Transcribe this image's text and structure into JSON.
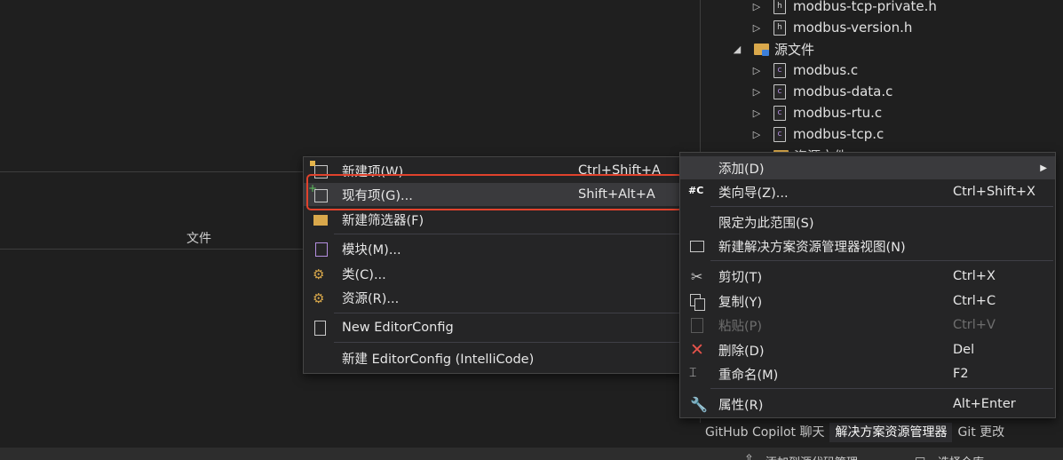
{
  "output_panel": {
    "column_file": "文件"
  },
  "solution_explorer": {
    "rows": [
      {
        "name": "modbus-tcp-private.h",
        "type": "h",
        "arrow": "▷"
      },
      {
        "name": "modbus-version.h",
        "type": "h",
        "arrow": "▷"
      },
      {
        "name": "源文件",
        "type": "folder",
        "arrow": "◢"
      },
      {
        "name": "modbus.c",
        "type": "c",
        "arrow": "▷"
      },
      {
        "name": "modbus-data.c",
        "type": "c",
        "arrow": "▷"
      },
      {
        "name": "modbus-rtu.c",
        "type": "c",
        "arrow": "▷"
      },
      {
        "name": "modbus-tcp.c",
        "type": "c",
        "arrow": "▷"
      },
      {
        "name": "资源文件",
        "type": "folder",
        "arrow": "▷"
      }
    ],
    "file_icon_h": "h",
    "file_icon_c": "c"
  },
  "tabs": [
    "GitHub Copilot 聊天",
    "解决方案资源管理器",
    "Git 更改"
  ],
  "status_bar": {
    "left": "添加到源代码管理",
    "right": "选择仓库"
  },
  "submenu": {
    "items": [
      {
        "label": "新建项(W)...",
        "shortcut": "Ctrl+Shift+A",
        "icon": "new-item-icon"
      },
      {
        "label": "现有项(G)...",
        "shortcut": "Shift+Alt+A",
        "icon": "existing-item-icon"
      },
      {
        "label": "新建筛选器(F)",
        "shortcut": "",
        "icon": "new-filter-icon"
      },
      {
        "label": "模块(M)...",
        "shortcut": "",
        "icon": "module-icon"
      },
      {
        "label": "类(C)...",
        "shortcut": "",
        "icon": "class-icon"
      },
      {
        "label": "资源(R)...",
        "shortcut": "",
        "icon": "resource-icon"
      },
      {
        "label": "New EditorConfig",
        "shortcut": "",
        "icon": "document-icon"
      },
      {
        "label": "新建 EditorConfig (IntelliCode)",
        "shortcut": "",
        "icon": ""
      }
    ]
  },
  "main_menu": {
    "items": [
      {
        "label": "添加(D)",
        "shortcut": "",
        "icon": ""
      },
      {
        "label": "类向导(Z)...",
        "shortcut": "Ctrl+Shift+X",
        "icon": "class-wizard-icon"
      },
      {
        "label": "限定为此范围(S)",
        "shortcut": "",
        "icon": ""
      },
      {
        "label": "新建解决方案资源管理器视图(N)",
        "shortcut": "",
        "icon": "new-view-icon"
      },
      {
        "label": "剪切(T)",
        "shortcut": "Ctrl+X",
        "icon": "scissors-icon"
      },
      {
        "label": "复制(Y)",
        "shortcut": "Ctrl+C",
        "icon": "copy-icon"
      },
      {
        "label": "粘贴(P)",
        "shortcut": "Ctrl+V",
        "icon": "paste-icon"
      },
      {
        "label": "删除(D)",
        "shortcut": "Del",
        "icon": "delete-icon"
      },
      {
        "label": "重命名(M)",
        "shortcut": "F2",
        "icon": "rename-icon"
      },
      {
        "label": "属性(R)",
        "shortcut": "Alt+Enter",
        "icon": "wrench-icon"
      }
    ],
    "class_wizard_badge": "#C",
    "delete_color": "#e5534b"
  },
  "highlight_color": "#e0422c"
}
